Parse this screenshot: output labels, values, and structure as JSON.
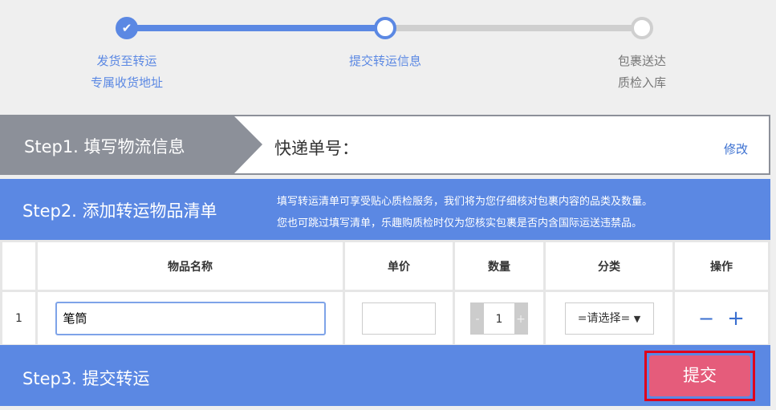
{
  "progress": {
    "steps": [
      {
        "line1": "发货至转运",
        "line2": "专属收货地址",
        "state": "done"
      },
      {
        "line1": "提交转运信息",
        "line2": "",
        "state": "current"
      },
      {
        "line1": "包裹送达",
        "line2": "质检入库",
        "state": "pending"
      }
    ]
  },
  "step1": {
    "title": "Step1. 填写物流信息",
    "tracking_label": "快递单号：",
    "edit_link": "修改"
  },
  "step2": {
    "title": "Step2. 添加转运物品清单",
    "note_line1": "填写转运清单可享受贴心质检服务，我们将为您仔细核对包裹内容的品类及数量。",
    "note_line2": "您也可跳过填写清单，乐趣购质检时仅为您核实包裹是否内含国际运送违禁品。"
  },
  "table": {
    "headers": [
      "",
      "物品名称",
      "单价",
      "数量",
      "分类",
      "操作"
    ],
    "rows": [
      {
        "index": "1",
        "name": "笔筒",
        "price": "",
        "qty": "1",
        "category": "=请选择=",
        "remove": "−",
        "add": "+"
      }
    ],
    "qty_minus": "-",
    "qty_plus": "+"
  },
  "step3": {
    "title": "Step3. 提交转运",
    "submit": "提交"
  },
  "colors": {
    "accent": "#5b88e3",
    "gray": "#8c9099",
    "submit": "#e55c7b",
    "highlight": "#e0001b"
  }
}
